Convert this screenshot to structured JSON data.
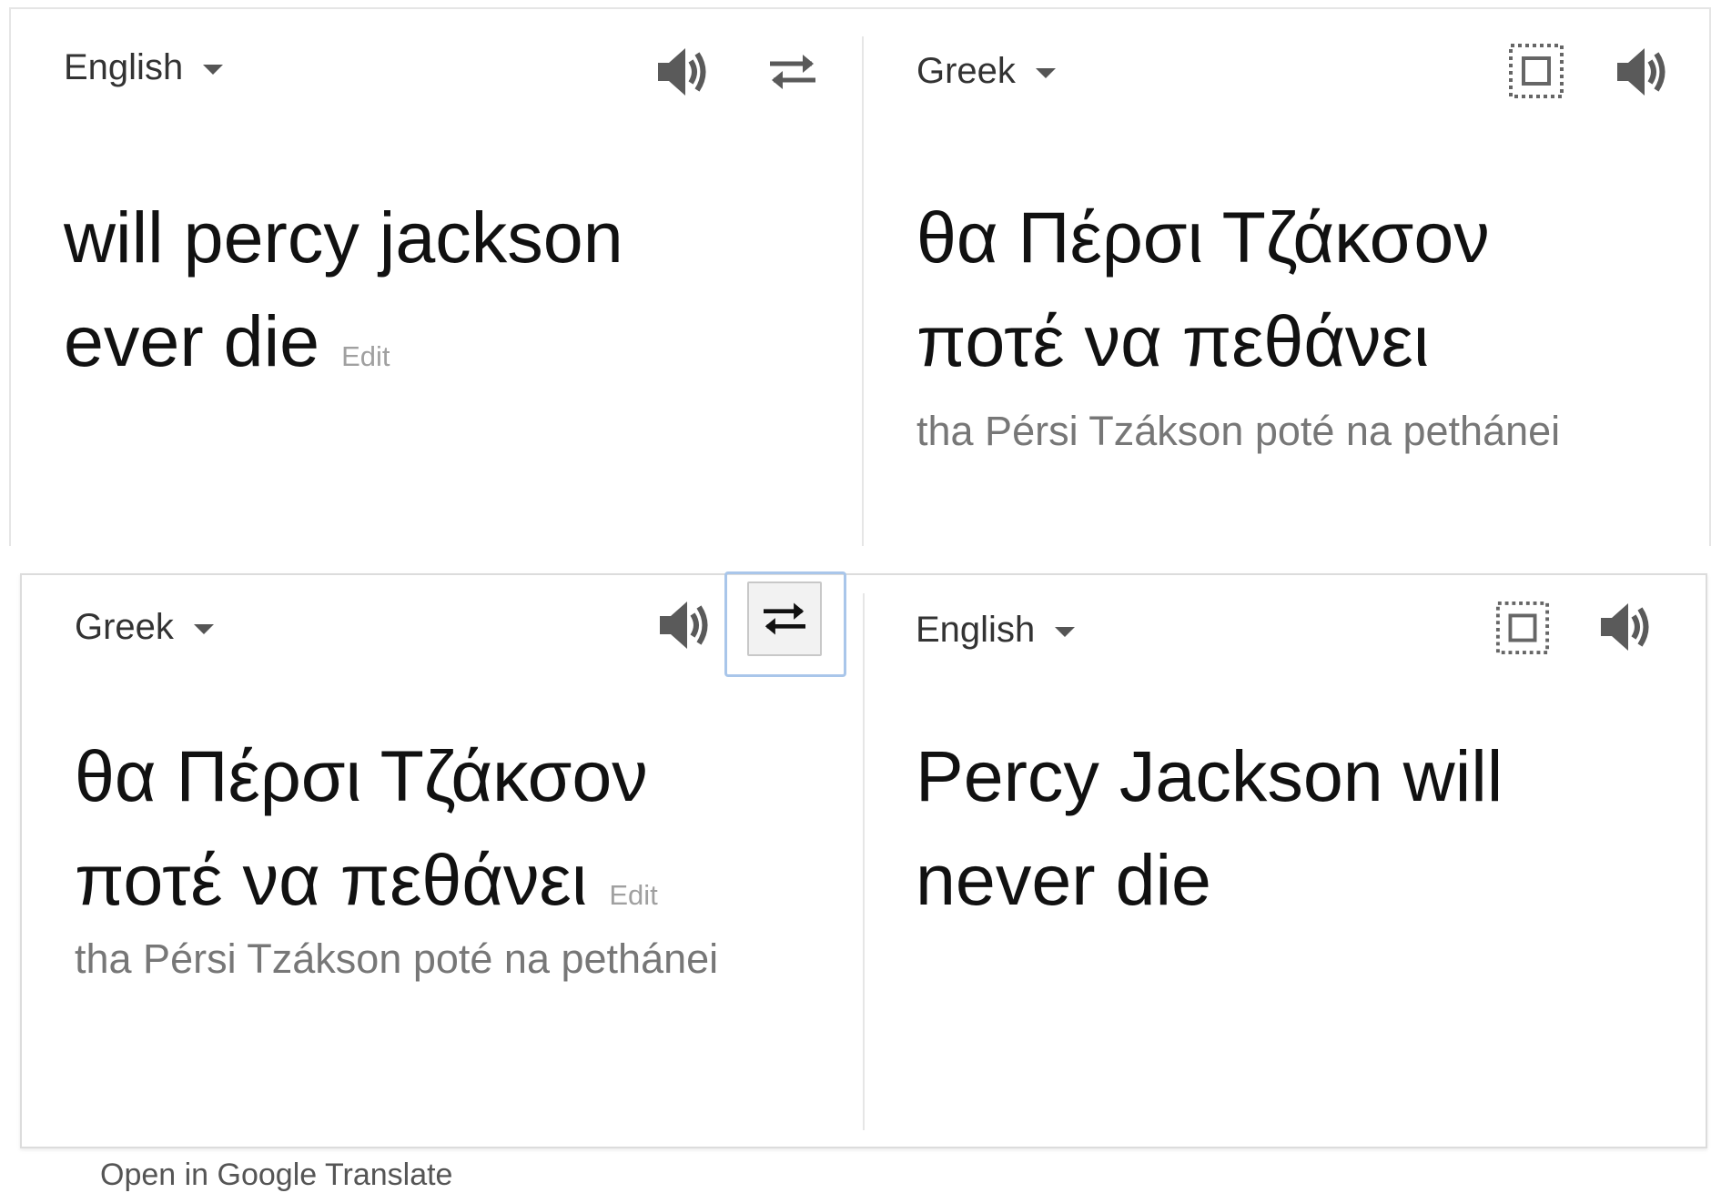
{
  "top": {
    "source_lang": "English",
    "target_lang": "Greek",
    "source_text_line1": "will percy jackson",
    "source_text_line2": "ever die",
    "edit_label": "Edit",
    "translation_line1": "θα Πέρσι Τζάκσον",
    "translation_line2": "ποτέ να πεθάνει",
    "transliteration": "tha Pérsi Tzákson poté na pethánei"
  },
  "bottom": {
    "source_lang": "Greek",
    "target_lang": "English",
    "source_text_line1": "θα Πέρσι Τζάκσον",
    "source_text_line2": "ποτέ να πεθάνει",
    "edit_label": "Edit",
    "transliteration": "tha Pérsi Tzákson poté na pethánei",
    "translation_line1": "Percy Jackson will",
    "translation_line2": "never die"
  },
  "footer": {
    "link_text": "Open in Google Translate"
  },
  "icons": {
    "speaker": "speaker-icon",
    "swap": "swap-languages-icon",
    "select": "select-all-icon",
    "caret": "chevron-down-icon"
  },
  "colors": {
    "text": "#111111",
    "secondary_text": "#777777",
    "edit_text": "#a0a0a0",
    "divider": "#e6e6e6",
    "focus_ring": "#a9c6ea"
  }
}
